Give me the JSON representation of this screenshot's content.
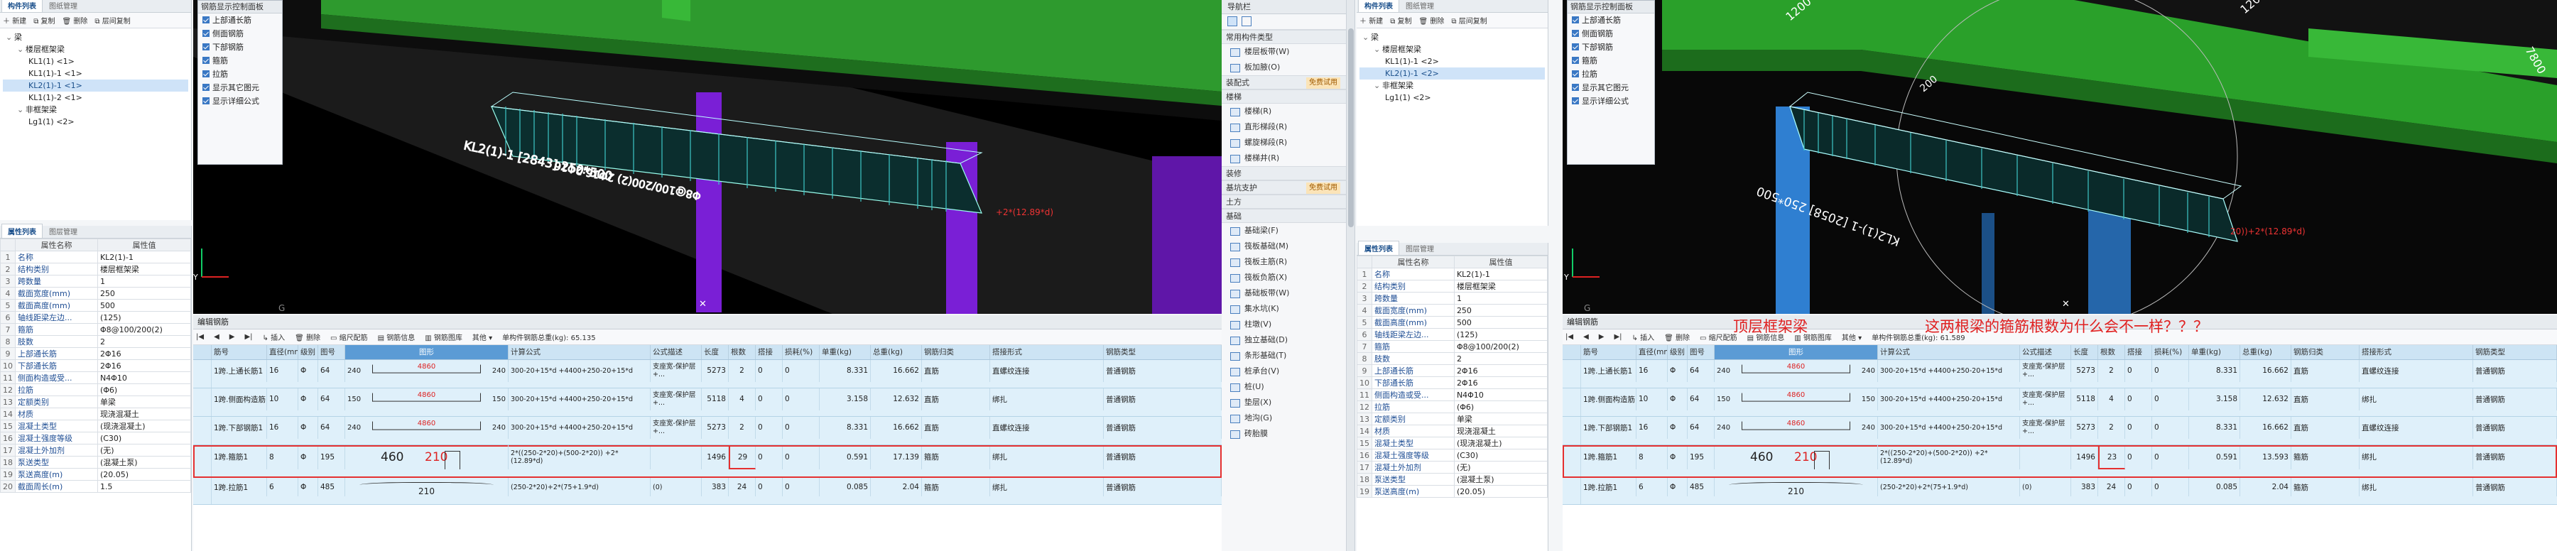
{
  "left": {
    "component_list": {
      "tabs": [
        "构件列表",
        "图纸管理"
      ],
      "toolbar": [
        "新建",
        "复制",
        "删除",
        "层间复制"
      ],
      "tree": [
        {
          "label": "梁",
          "level": 0,
          "expander": "⌄"
        },
        {
          "label": "楼层框架梁",
          "level": 1,
          "expander": "⌄"
        },
        {
          "label": "KL1(1) <1>",
          "level": 2
        },
        {
          "label": "KL1(1)-1 <1>",
          "level": 2
        },
        {
          "label": "KL2(1)-1 <1>",
          "level": 2,
          "selected": true
        },
        {
          "label": "KL1(1)-2 <1>",
          "level": 2
        },
        {
          "label": "非框架梁",
          "level": 1,
          "expander": "⌄"
        },
        {
          "label": "Lg1(1) <2>",
          "level": 2
        }
      ]
    },
    "props": {
      "tabs": [
        "属性列表",
        "图层管理"
      ],
      "col_name": "属性名称",
      "col_value": "属性值",
      "rows": [
        {
          "n": "1",
          "name": "名称",
          "value": "KL2(1)-1"
        },
        {
          "n": "2",
          "name": "结构类别",
          "value": "楼层框架梁"
        },
        {
          "n": "3",
          "name": "跨数量",
          "value": "1"
        },
        {
          "n": "4",
          "name": "截面宽度(mm)",
          "value": "250"
        },
        {
          "n": "5",
          "name": "截面高度(mm)",
          "value": "500"
        },
        {
          "n": "6",
          "name": "轴线距梁左边...",
          "value": "(125)"
        },
        {
          "n": "7",
          "name": "箍筋",
          "value": "Φ8@100/200(2)"
        },
        {
          "n": "8",
          "name": "肢数",
          "value": "2"
        },
        {
          "n": "9",
          "name": "上部通长筋",
          "value": "2Φ16"
        },
        {
          "n": "10",
          "name": "下部通长筋",
          "value": "2Φ16"
        },
        {
          "n": "11",
          "name": "侧面构造或受...",
          "value": "N4Φ10"
        },
        {
          "n": "12",
          "name": "拉筋",
          "value": "(Φ6)"
        },
        {
          "n": "13",
          "name": "定额类别",
          "value": "单梁"
        },
        {
          "n": "14",
          "name": "材质",
          "value": "现浇混凝土"
        },
        {
          "n": "15",
          "name": "混凝土类型",
          "value": "(现浇混凝土)"
        },
        {
          "n": "16",
          "name": "混凝土强度等级",
          "value": "(C30)"
        },
        {
          "n": "17",
          "name": "混凝土外加剂",
          "value": "(无)"
        },
        {
          "n": "18",
          "name": "泵送类型",
          "value": "(混凝土泵)"
        },
        {
          "n": "19",
          "name": "泵送高度(m)",
          "value": "(20.05)"
        },
        {
          "n": "20",
          "name": "截面周长(m)",
          "value": "1.5"
        }
      ]
    },
    "control_panel": {
      "title": "钢筋显示控制面板",
      "items": [
        "上部通长筋",
        "侧面钢筋",
        "下部钢筋",
        "箍筋",
        "拉筋",
        "显示其它图元",
        "显示详细公式"
      ]
    },
    "viewport": {
      "beam_label": "KL2(1)-1 [2843] 250*500",
      "beam_label2": "Φ8@100/200(2) 2Φ16;2Φ16",
      "formula_tail": "+2*(12.89*d)",
      "axis_letter": "G"
    },
    "rebar_editor": {
      "title": "编辑钢筋",
      "toolbar": [
        "插入",
        "删除",
        "缩尺配筋",
        "钢筋信息",
        "钢筋图库",
        "其他",
        "单构件钢筋总重(kg): 65.135"
      ],
      "columns": [
        "筋号",
        "直径(mm)",
        "级别",
        "图号",
        "图形",
        "计算公式",
        "公式描述",
        "长度",
        "根数",
        "搭接",
        "损耗(%)",
        "单重(kg)",
        "总重(kg)",
        "钢筋归类",
        "搭接形式",
        "钢筋类型"
      ],
      "rows": [
        {
          "id": "1跨.上通长筋1",
          "d": "16",
          "grade": "Φ",
          "fig": "64",
          "left": "240",
          "mid": "4860",
          "right": "240",
          "formula": "300-20+15*d +4400+250-20+15*d",
          "desc": "支座宽-保护层+...",
          "len": "5273",
          "count": "2",
          "lap": "0",
          "loss": "0",
          "unit": "8.331",
          "total": "16.662",
          "cat": "直筋",
          "lapform": "直螺纹连接",
          "type": "普通钢筋"
        },
        {
          "id": "1跨.侧面构造筋1",
          "d": "10",
          "grade": "Φ",
          "fig": "64",
          "left": "150",
          "mid": "4860",
          "right": "150",
          "formula": "300-20+15*d +4400+250-20+15*d",
          "desc": "支座宽-保护层+...",
          "len": "5118",
          "count": "4",
          "lap": "0",
          "loss": "0",
          "unit": "3.158",
          "total": "12.632",
          "cat": "直筋",
          "lapform": "绑扎",
          "type": "普通钢筋"
        },
        {
          "id": "1跨.下部钢筋1",
          "d": "16",
          "grade": "Φ",
          "fig": "64",
          "left": "240",
          "mid": "4860",
          "right": "240",
          "formula": "300-20+15*d +4400+250-20+15*d",
          "desc": "支座宽-保护层+...",
          "len": "5273",
          "count": "2",
          "lap": "0",
          "loss": "0",
          "unit": "8.331",
          "total": "16.662",
          "cat": "直筋",
          "lapform": "直螺纹连接",
          "type": "普通钢筋"
        },
        {
          "id": "1跨.箍筋1",
          "d": "8",
          "grade": "Φ",
          "fig": "195",
          "h": "460",
          "w": "210",
          "formula": "2*((250-2*20)+(500-2*20)) +2*(12.89*d)",
          "desc": "",
          "len": "1496",
          "count": "29",
          "lap": "0",
          "loss": "0",
          "unit": "0.591",
          "total": "17.139",
          "cat": "箍筋",
          "lapform": "绑扎",
          "type": "普通钢筋"
        },
        {
          "id": "1跨.拉筋1",
          "d": "6",
          "grade": "Φ",
          "fig": "485",
          "mid": "210",
          "formula": "(250-2*20)+2*(75+1.9*d)",
          "desc": "(0)",
          "len": "383",
          "count": "24",
          "lap": "0",
          "loss": "0",
          "unit": "0.085",
          "total": "2.04",
          "cat": "箍筋",
          "lapform": "绑扎",
          "type": "普通钢筋"
        }
      ]
    }
  },
  "middle_nav": {
    "title": "导航栏",
    "sections": [
      {
        "label": "常用构件类型",
        "badge": "",
        "items": [
          "楼层板带(W)",
          "板加腋(O)"
        ]
      },
      {
        "label": "装配式",
        "badge": "免费试用",
        "items": []
      },
      {
        "label": "楼梯",
        "badge": "",
        "items": [
          "楼梯(R)",
          "直形梯段(R)",
          "螺旋梯段(R)",
          "楼梯井(R)"
        ]
      },
      {
        "label": "装修",
        "badge": "",
        "items": []
      },
      {
        "label": "基坑支护",
        "badge": "免费试用",
        "items": []
      },
      {
        "label": "土方",
        "badge": "",
        "items": []
      },
      {
        "label": "基础",
        "badge": "",
        "items": [
          "基础梁(F)",
          "筏板基础(M)",
          "筏板主筋(R)",
          "筏板负筋(X)",
          "基础板带(W)",
          "集水坑(K)",
          "柱墩(V)",
          "独立基础(D)",
          "条形基础(T)",
          "桩承台(V)",
          "桩(U)",
          "垫层(X)",
          "地沟(G)",
          "砖胎膜"
        ]
      }
    ]
  },
  "right": {
    "component_list": {
      "tabs": [
        "构件列表",
        "图纸管理"
      ],
      "toolbar": [
        "新建",
        "复制",
        "删除",
        "层间复制"
      ],
      "tree": [
        {
          "label": "梁",
          "level": 0,
          "expander": "⌄"
        },
        {
          "label": "楼层框架梁",
          "level": 1,
          "expander": "⌄"
        },
        {
          "label": "KL1(1)-1 <2>",
          "level": 2
        },
        {
          "label": "KL2(1)-1 <2>",
          "level": 2,
          "selected": true
        },
        {
          "label": "非框架梁",
          "level": 1,
          "expander": "⌄"
        },
        {
          "label": "Lg1(1) <2>",
          "level": 2
        }
      ]
    },
    "props": {
      "tabs": [
        "属性列表",
        "图层管理"
      ],
      "col_name": "属性名称",
      "col_value": "属性值",
      "rows": [
        {
          "n": "1",
          "name": "名称",
          "value": "KL2(1)-1"
        },
        {
          "n": "2",
          "name": "结构类别",
          "value": "楼层框架梁"
        },
        {
          "n": "3",
          "name": "跨数量",
          "value": "1"
        },
        {
          "n": "4",
          "name": "截面宽度(mm)",
          "value": "250"
        },
        {
          "n": "5",
          "name": "截面高度(mm)",
          "value": "500"
        },
        {
          "n": "6",
          "name": "轴线距梁左边...",
          "value": "(125)"
        },
        {
          "n": "7",
          "name": "箍筋",
          "value": "Φ8@100/200(2)"
        },
        {
          "n": "8",
          "name": "肢数",
          "value": "2"
        },
        {
          "n": "9",
          "name": "上部通长筋",
          "value": "2Φ16"
        },
        {
          "n": "10",
          "name": "下部通长筋",
          "value": "2Φ16"
        },
        {
          "n": "11",
          "name": "侧面构造或受...",
          "value": "N4Φ10"
        },
        {
          "n": "12",
          "name": "拉筋",
          "value": "(Φ6)"
        },
        {
          "n": "13",
          "name": "定额类别",
          "value": "单梁"
        },
        {
          "n": "14",
          "name": "材质",
          "value": "现浇混凝土"
        },
        {
          "n": "15",
          "name": "混凝土类型",
          "value": "(现浇混凝土)"
        },
        {
          "n": "16",
          "name": "混凝土强度等级",
          "value": "(C30)"
        },
        {
          "n": "17",
          "name": "混凝土外加剂",
          "value": "(无)"
        },
        {
          "n": "18",
          "name": "泵送类型",
          "value": "(混凝土泵)"
        },
        {
          "n": "19",
          "name": "泵送高度(m)",
          "value": "(20.05)"
        }
      ]
    },
    "control_panel": {
      "title": "钢筋显示控制面板",
      "items": [
        "上部通长筋",
        "侧面钢筋",
        "下部钢筋",
        "箍筋",
        "拉筋",
        "显示其它图元",
        "显示详细公式"
      ]
    },
    "viewport": {
      "dims": [
        "1200",
        "1200",
        "7800",
        "200"
      ],
      "beam_label": "KL2(1)-1 [2058] 250*500",
      "formula_tail": "20))+2*(12.89*d)",
      "axis_letter": "G"
    },
    "annotation": {
      "line1": "顶层框架梁",
      "line2": "这两根梁的箍筋根数为什么会不一样？？？"
    },
    "rebar_editor": {
      "title": "编辑钢筋",
      "toolbar": [
        "插入",
        "删除",
        "缩尺配筋",
        "钢筋信息",
        "钢筋图库",
        "其他",
        "单构件钢筋总重(kg): 61.589"
      ],
      "columns": [
        "筋号",
        "直径(mm)",
        "级别",
        "图号",
        "图形",
        "计算公式",
        "公式描述",
        "长度",
        "根数",
        "搭接",
        "损耗(%)",
        "单重(kg)",
        "总重(kg)",
        "钢筋归类",
        "搭接形式",
        "钢筋类型"
      ],
      "rows": [
        {
          "id": "1跨.上通长筋1",
          "d": "16",
          "grade": "Φ",
          "fig": "64",
          "left": "240",
          "mid": "4860",
          "right": "240",
          "formula": "300-20+15*d +4400+250-20+15*d",
          "desc": "支座宽-保护层+...",
          "len": "5273",
          "count": "2",
          "lap": "0",
          "loss": "0",
          "unit": "8.331",
          "total": "16.662",
          "cat": "直筋",
          "lapform": "直螺纹连接",
          "type": "普通钢筋"
        },
        {
          "id": "1跨.侧面构造筋1",
          "d": "10",
          "grade": "Φ",
          "fig": "64",
          "left": "150",
          "mid": "4860",
          "right": "150",
          "formula": "300-20+15*d +4400+250-20+15*d",
          "desc": "支座宽-保护层+...",
          "len": "5118",
          "count": "4",
          "lap": "0",
          "loss": "0",
          "unit": "3.158",
          "total": "12.632",
          "cat": "直筋",
          "lapform": "绑扎",
          "type": "普通钢筋"
        },
        {
          "id": "1跨.下部钢筋1",
          "d": "16",
          "grade": "Φ",
          "fig": "64",
          "left": "240",
          "mid": "4860",
          "right": "240",
          "formula": "300-20+15*d +4400+250-20+15*d",
          "desc": "支座宽-保护层+...",
          "len": "5273",
          "count": "2",
          "lap": "0",
          "loss": "0",
          "unit": "8.331",
          "total": "16.662",
          "cat": "直筋",
          "lapform": "直螺纹连接",
          "type": "普通钢筋"
        },
        {
          "id": "1跨.箍筋1",
          "d": "8",
          "grade": "Φ",
          "fig": "195",
          "h": "460",
          "w": "210",
          "formula": "2*((250-2*20)+(500-2*20)) +2*(12.89*d)",
          "desc": "",
          "len": "1496",
          "count": "23",
          "lap": "0",
          "loss": "0",
          "unit": "0.591",
          "total": "13.593",
          "cat": "箍筋",
          "lapform": "绑扎",
          "type": "普通钢筋"
        },
        {
          "id": "1跨.拉筋1",
          "d": "6",
          "grade": "Φ",
          "fig": "485",
          "mid": "210",
          "formula": "(250-2*20)+2*(75+1.9*d)",
          "desc": "(0)",
          "len": "383",
          "count": "24",
          "lap": "0",
          "loss": "0",
          "unit": "0.085",
          "total": "2.04",
          "cat": "箍筋",
          "lapform": "绑扎",
          "type": "普通钢筋"
        }
      ]
    }
  },
  "colors": {
    "highlight": "#e53030",
    "beam_green": "#2aa02a",
    "column_purple": "#7a1fd6",
    "column_blue": "#2f7fd1"
  }
}
